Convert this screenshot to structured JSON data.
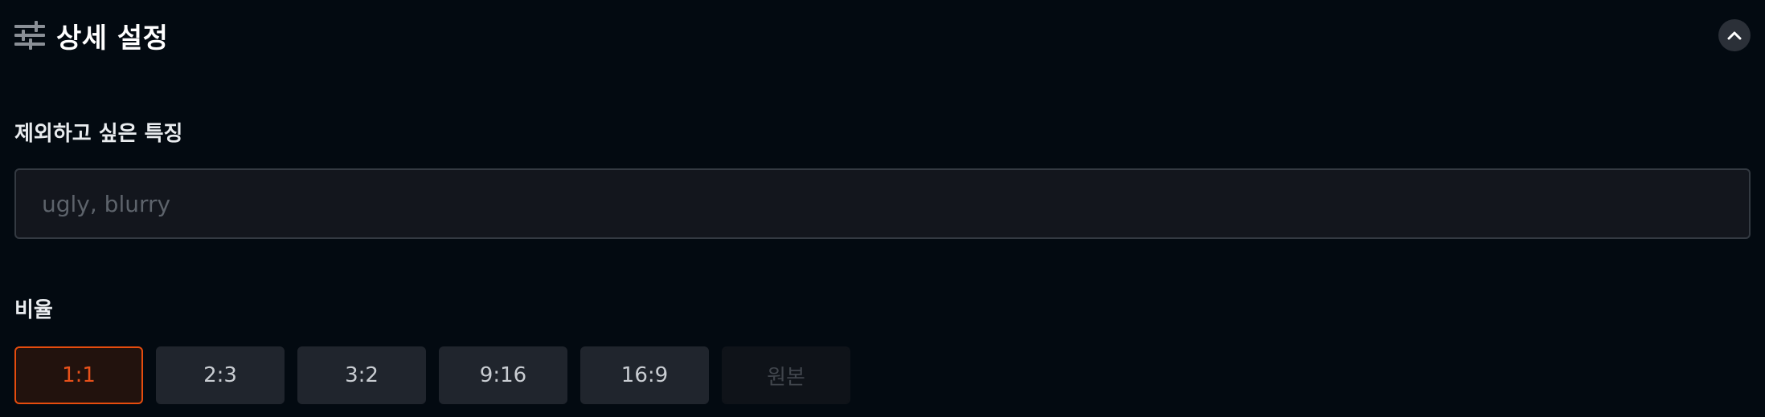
{
  "header": {
    "title": "상세 설정",
    "icon": "sliders-icon",
    "collapse_icon": "chevron-up-icon"
  },
  "negative_prompt": {
    "label": "제외하고 싶은 특징",
    "value": "",
    "placeholder": "ugly, blurry"
  },
  "ratio": {
    "label": "비율",
    "options": [
      {
        "label": "1:1",
        "state": "selected"
      },
      {
        "label": "2:3",
        "state": "normal"
      },
      {
        "label": "3:2",
        "state": "normal"
      },
      {
        "label": "9:16",
        "state": "normal"
      },
      {
        "label": "16:9",
        "state": "normal"
      },
      {
        "label": "원본",
        "state": "disabled"
      }
    ],
    "selected": "1:1"
  },
  "colors": {
    "background": "#030a11",
    "accent": "#e54c0e",
    "button_bg": "#20252d",
    "input_bg": "#13161d"
  }
}
